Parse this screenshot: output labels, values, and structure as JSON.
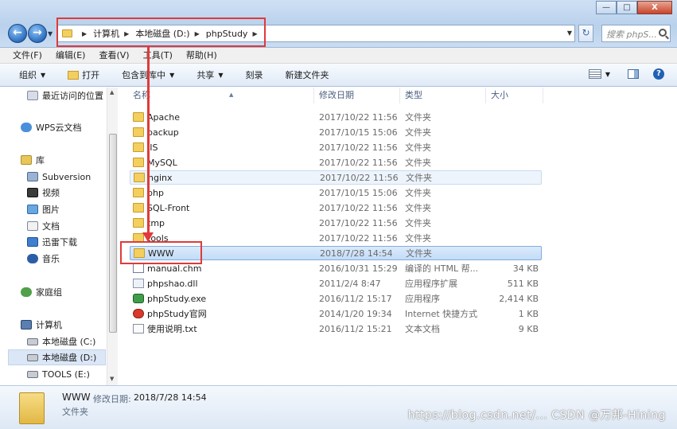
{
  "window": {
    "buttons": {
      "minimize": "—",
      "maximize": "□",
      "close": "X"
    }
  },
  "address": {
    "crumbs": [
      "计算机",
      "本地磁盘 (D:)",
      "phpStudy"
    ],
    "search_placeholder": "搜索 phpS..."
  },
  "menu": [
    "文件(F)",
    "编辑(E)",
    "查看(V)",
    "工具(T)",
    "帮助(H)"
  ],
  "toolbar": {
    "organize": "组织",
    "open": "打开",
    "include": "包含到库中",
    "share": "共享",
    "burn": "刻录",
    "new_folder": "新建文件夹"
  },
  "sidebar": [
    {
      "label": "最近访问的位置",
      "icon": "recent-places-icon"
    },
    {
      "label": "WPS云文档",
      "icon": "cloud-icon"
    },
    {
      "label": "库",
      "icon": "library-icon"
    },
    {
      "label": "Subversion",
      "icon": "svn-icon"
    },
    {
      "label": "视频",
      "icon": "video-icon"
    },
    {
      "label": "图片",
      "icon": "pictures-icon"
    },
    {
      "label": "文档",
      "icon": "documents-icon"
    },
    {
      "label": "迅雷下载",
      "icon": "download-icon"
    },
    {
      "label": "音乐",
      "icon": "music-icon"
    },
    {
      "label": "家庭组",
      "icon": "homegroup-icon"
    },
    {
      "label": "计算机",
      "icon": "computer-icon"
    },
    {
      "label": "本地磁盘 (C:)",
      "icon": "drive-icon"
    },
    {
      "label": "本地磁盘 (D:)",
      "icon": "drive-icon",
      "selected": true
    },
    {
      "label": "TOOLS  (E:)",
      "icon": "drive-icon"
    }
  ],
  "columns": {
    "name": "名称",
    "date": "修改日期",
    "type": "类型",
    "size": "大小"
  },
  "files": [
    {
      "name": "Apache",
      "date": "2017/10/22 11:56",
      "type": "文件夹",
      "size": "",
      "icon": "folder-icon"
    },
    {
      "name": "backup",
      "date": "2017/10/15 15:06",
      "type": "文件夹",
      "size": "",
      "icon": "folder-icon"
    },
    {
      "name": "IIS",
      "date": "2017/10/22 11:56",
      "type": "文件夹",
      "size": "",
      "icon": "folder-icon"
    },
    {
      "name": "MySQL",
      "date": "2017/10/22 11:56",
      "type": "文件夹",
      "size": "",
      "icon": "folder-icon"
    },
    {
      "name": "nginx",
      "date": "2017/10/22 11:56",
      "type": "文件夹",
      "size": "",
      "icon": "folder-icon"
    },
    {
      "name": "php",
      "date": "2017/10/15 15:06",
      "type": "文件夹",
      "size": "",
      "icon": "folder-icon"
    },
    {
      "name": "SQL-Front",
      "date": "2017/10/22 11:56",
      "type": "文件夹",
      "size": "",
      "icon": "folder-icon"
    },
    {
      "name": "tmp",
      "date": "2017/10/22 11:56",
      "type": "文件夹",
      "size": "",
      "icon": "folder-icon"
    },
    {
      "name": "tools",
      "date": "2017/10/22 11:56",
      "type": "文件夹",
      "size": "",
      "icon": "folder-icon"
    },
    {
      "name": "WWW",
      "date": "2018/7/28 14:54",
      "type": "文件夹",
      "size": "",
      "icon": "folder-icon"
    },
    {
      "name": "manual.chm",
      "date": "2016/10/31 15:29",
      "type": "编译的 HTML 帮...",
      "size": "34 KB",
      "icon": "chm-file-icon"
    },
    {
      "name": "phpshao.dll",
      "date": "2011/2/4 8:47",
      "type": "应用程序扩展",
      "size": "511 KB",
      "icon": "dll-file-icon"
    },
    {
      "name": "phpStudy.exe",
      "date": "2016/11/2 15:17",
      "type": "应用程序",
      "size": "2,414 KB",
      "icon": "exe-file-icon"
    },
    {
      "name": "phpStudy官网",
      "date": "2014/1/20 19:34",
      "type": "Internet 快捷方式",
      "size": "1 KB",
      "icon": "url-shortcut-icon"
    },
    {
      "name": "使用说明.txt",
      "date": "2016/11/2 15:21",
      "type": "文本文档",
      "size": "9 KB",
      "icon": "txt-file-icon"
    }
  ],
  "details": {
    "name": "WWW",
    "date_label": "修改日期:",
    "date": "2018/7/28 14:54",
    "type": "文件夹"
  },
  "watermark": "https://blog.csdn.net/... CSDN @万邦-Hining",
  "colors": {
    "annotation": "#e03a3a",
    "selection": "#c3dcf7"
  }
}
